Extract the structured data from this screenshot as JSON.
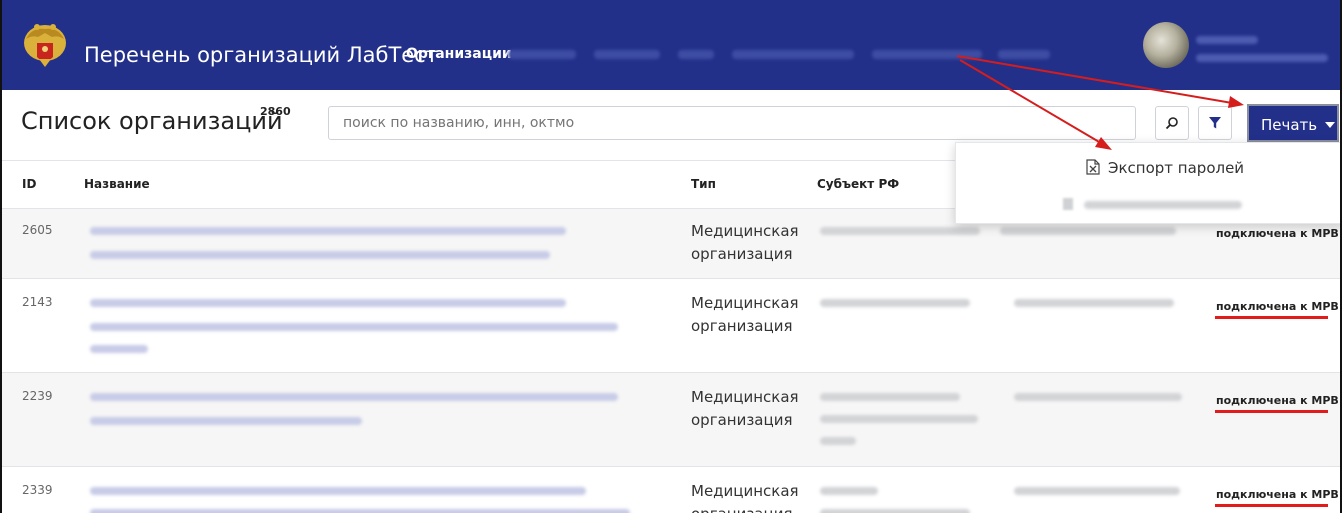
{
  "navbar": {
    "brand": "Перечень организаций ЛабТест",
    "active_item": "Организации",
    "avatar_icon": "user-avatar"
  },
  "page": {
    "title": "Список организаций",
    "count": "2860"
  },
  "search": {
    "placeholder": "поиск по названию, инн, октмо"
  },
  "toolbar": {
    "search_icon": "search-icon",
    "filter_icon": "filter-icon",
    "print_label": "Печать"
  },
  "dropdown": {
    "items": [
      {
        "label": "Экспорт паролей",
        "icon": "excel-file-icon"
      },
      {
        "label": "",
        "icon": "excel-file-icon"
      }
    ]
  },
  "table": {
    "columns": [
      "ID",
      "Название",
      "Тип",
      "Субъект РФ"
    ],
    "rows": [
      {
        "id": "2605",
        "type_line1": "Медицинская",
        "type_line2": "организация",
        "status": "подключена к МРВ"
      },
      {
        "id": "2143",
        "type_line1": "Медицинская",
        "type_line2": "организация",
        "status": "подключена к МРВ"
      },
      {
        "id": "2239",
        "type_line1": "Медицинская",
        "type_line2": "организация",
        "status": "подключена к МРВ"
      },
      {
        "id": "2339",
        "type_line1": "Медицинская",
        "type_line2": "организация",
        "status": "подключена к МРВ"
      }
    ]
  },
  "colors": {
    "navbar": "#23308a",
    "annotation": "#d61d1d"
  }
}
